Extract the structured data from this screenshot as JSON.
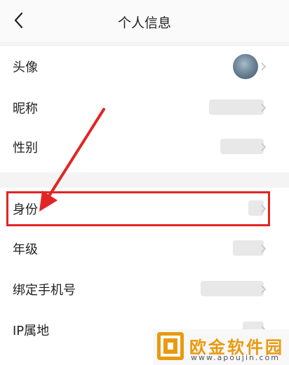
{
  "header": {
    "title": "个人信息",
    "back_icon": "chevron-left-icon"
  },
  "rows": [
    {
      "label": "头像"
    },
    {
      "label": "昵称"
    },
    {
      "label": "性别"
    },
    {
      "label": "身份"
    },
    {
      "label": "年级"
    },
    {
      "label": "绑定手机号"
    },
    {
      "label": "IP属地"
    }
  ],
  "annotation": {
    "highlight_color": "#e12525",
    "arrow_color": "#e12525"
  },
  "watermark": {
    "name": "欧金软件园",
    "url": "www.apoujin.com",
    "brand_color": "#e89a10"
  }
}
